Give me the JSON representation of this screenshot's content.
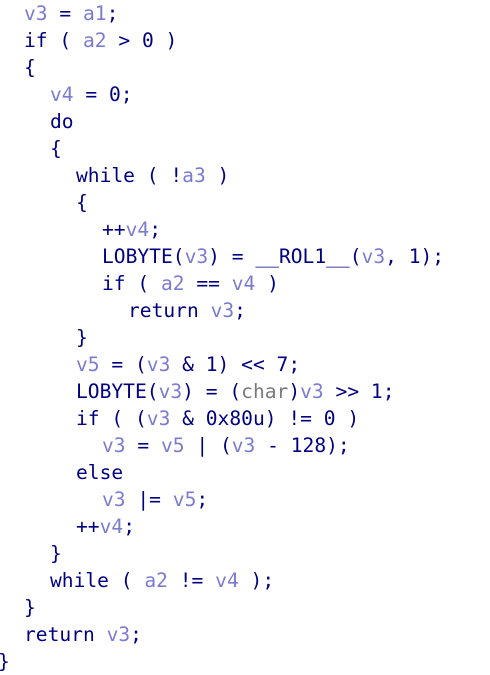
{
  "colors": {
    "background": "#ffffff",
    "code": "#000080",
    "variable": "#7b7bd0",
    "type": "#7a7a7a"
  },
  "lines": [
    {
      "indent": 1,
      "tokens": [
        [
          "var",
          "v3"
        ],
        [
          "p",
          " = "
        ],
        [
          "var",
          "a1"
        ],
        [
          "p",
          ";"
        ]
      ]
    },
    {
      "indent": 1,
      "tokens": [
        [
          "kw",
          "if"
        ],
        [
          "p",
          " ( "
        ],
        [
          "var",
          "a2"
        ],
        [
          "p",
          " > 0 )"
        ]
      ]
    },
    {
      "indent": 1,
      "tokens": [
        [
          "p",
          "{"
        ]
      ]
    },
    {
      "indent": 2,
      "tokens": [
        [
          "var",
          "v4"
        ],
        [
          "p",
          " = 0;"
        ]
      ]
    },
    {
      "indent": 2,
      "tokens": [
        [
          "kw",
          "do"
        ]
      ]
    },
    {
      "indent": 2,
      "tokens": [
        [
          "p",
          "{"
        ]
      ]
    },
    {
      "indent": 3,
      "tokens": [
        [
          "kw",
          "while"
        ],
        [
          "p",
          " ( !"
        ],
        [
          "var",
          "a3"
        ],
        [
          "p",
          " )"
        ]
      ]
    },
    {
      "indent": 3,
      "tokens": [
        [
          "p",
          "{"
        ]
      ]
    },
    {
      "indent": 4,
      "tokens": [
        [
          "p",
          "++"
        ],
        [
          "var",
          "v4"
        ],
        [
          "p",
          ";"
        ]
      ]
    },
    {
      "indent": 4,
      "tokens": [
        [
          "id",
          "LOBYTE"
        ],
        [
          "p",
          "("
        ],
        [
          "var",
          "v3"
        ],
        [
          "p",
          ") = "
        ],
        [
          "id",
          "__ROL1__"
        ],
        [
          "p",
          "("
        ],
        [
          "var",
          "v3"
        ],
        [
          "p",
          ", 1);"
        ]
      ]
    },
    {
      "indent": 4,
      "tokens": [
        [
          "kw",
          "if"
        ],
        [
          "p",
          " ( "
        ],
        [
          "var",
          "a2"
        ],
        [
          "p",
          " == "
        ],
        [
          "var",
          "v4"
        ],
        [
          "p",
          " )"
        ]
      ]
    },
    {
      "indent": 5,
      "tokens": [
        [
          "kw",
          "return"
        ],
        [
          "p",
          " "
        ],
        [
          "var",
          "v3"
        ],
        [
          "p",
          ";"
        ]
      ]
    },
    {
      "indent": 3,
      "tokens": [
        [
          "p",
          "}"
        ]
      ]
    },
    {
      "indent": 3,
      "tokens": [
        [
          "var",
          "v5"
        ],
        [
          "p",
          " = ("
        ],
        [
          "var",
          "v3"
        ],
        [
          "p",
          " & 1) << 7;"
        ]
      ]
    },
    {
      "indent": 3,
      "tokens": [
        [
          "id",
          "LOBYTE"
        ],
        [
          "p",
          "("
        ],
        [
          "var",
          "v3"
        ],
        [
          "p",
          ") = ("
        ],
        [
          "type",
          "char"
        ],
        [
          "p",
          ")"
        ],
        [
          "var",
          "v3"
        ],
        [
          "p",
          " >> 1;"
        ]
      ]
    },
    {
      "indent": 3,
      "tokens": [
        [
          "kw",
          "if"
        ],
        [
          "p",
          " ( ("
        ],
        [
          "var",
          "v3"
        ],
        [
          "p",
          " & 0x80u) != 0 )"
        ]
      ]
    },
    {
      "indent": 4,
      "tokens": [
        [
          "var",
          "v3"
        ],
        [
          "p",
          " = "
        ],
        [
          "var",
          "v5"
        ],
        [
          "p",
          " | ("
        ],
        [
          "var",
          "v3"
        ],
        [
          "p",
          " - 128);"
        ]
      ]
    },
    {
      "indent": 3,
      "tokens": [
        [
          "kw",
          "else"
        ]
      ]
    },
    {
      "indent": 4,
      "tokens": [
        [
          "var",
          "v3"
        ],
        [
          "p",
          " |= "
        ],
        [
          "var",
          "v5"
        ],
        [
          "p",
          ";"
        ]
      ]
    },
    {
      "indent": 3,
      "tokens": [
        [
          "p",
          "++"
        ],
        [
          "var",
          "v4"
        ],
        [
          "p",
          ";"
        ]
      ]
    },
    {
      "indent": 2,
      "tokens": [
        [
          "p",
          "}"
        ]
      ]
    },
    {
      "indent": 2,
      "tokens": [
        [
          "kw",
          "while"
        ],
        [
          "p",
          " ( "
        ],
        [
          "var",
          "a2"
        ],
        [
          "p",
          " != "
        ],
        [
          "var",
          "v4"
        ],
        [
          "p",
          " );"
        ]
      ]
    },
    {
      "indent": 1,
      "tokens": [
        [
          "p",
          "}"
        ]
      ]
    },
    {
      "indent": 1,
      "tokens": [
        [
          "kw",
          "return"
        ],
        [
          "p",
          " "
        ],
        [
          "var",
          "v3"
        ],
        [
          "p",
          ";"
        ]
      ]
    },
    {
      "indent": 0,
      "tokens": [
        [
          "p",
          "}"
        ]
      ]
    }
  ]
}
